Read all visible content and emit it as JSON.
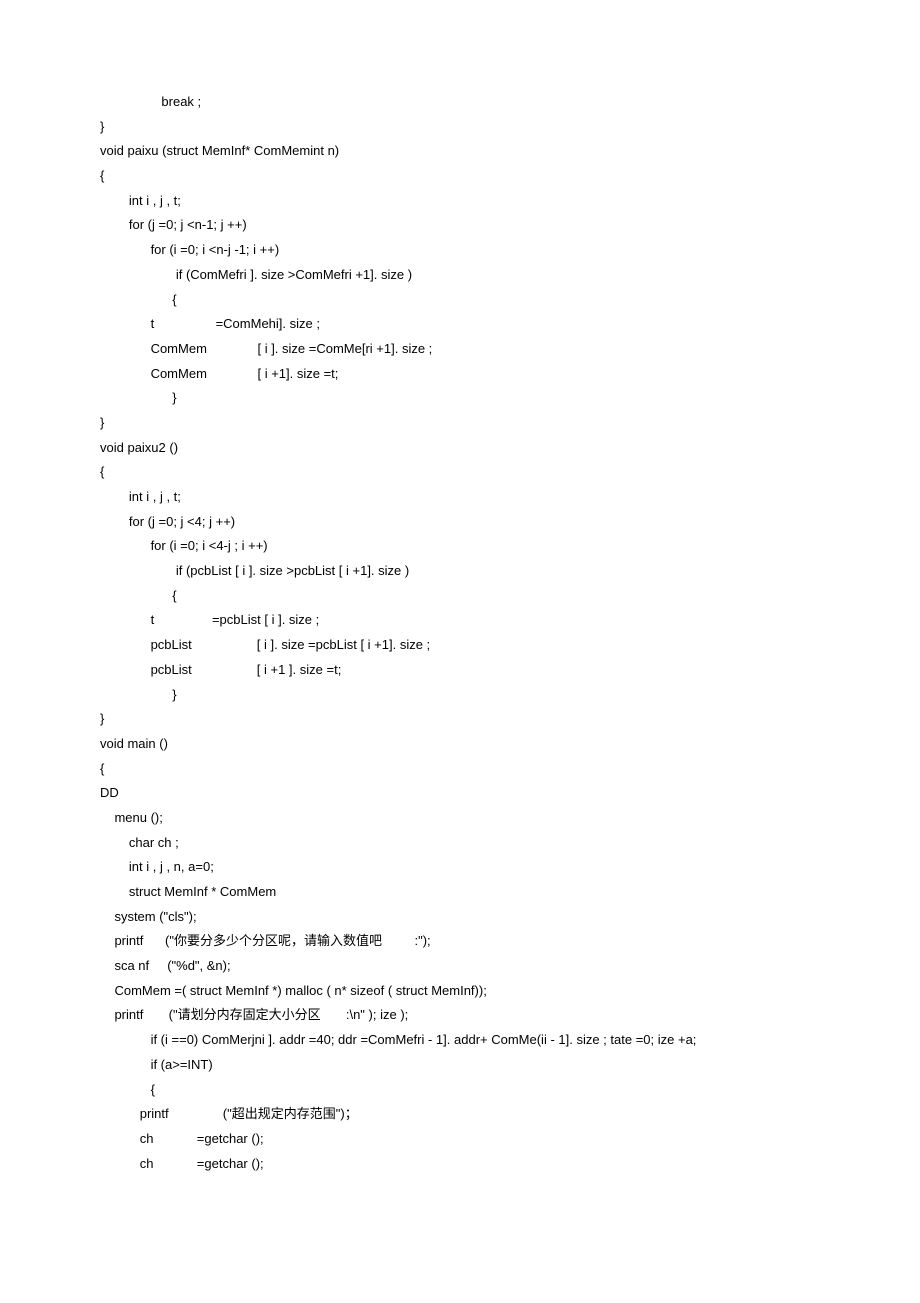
{
  "lines": [
    "                 break ;",
    "}",
    "void paixu (struct MemInf* ComMemint n)",
    "{",
    "        int i , j , t;",
    "        for (j =0; j <n-1; j ++)",
    "              for (i =0; i <n-j -1; i ++)",
    "                     if (ComMefri ]. size >ComMefri +1]. size )",
    "                    {",
    "              t                 =ComMehi]. size ;",
    "              ComMem              [ i ]. size =ComMe[ri +1]. size ;",
    "              ComMem              [ i +1]. size =t;",
    "                    }",
    "}",
    "void paixu2 ()",
    "{",
    "        int i , j , t;",
    "        for (j =0; j <4; j ++)",
    "              for (i =0; i <4-j ; i ++)",
    "                     if (pcbList [ i ]. size >pcbList [ i +1]. size )",
    "                    {",
    "              t                =pcbList [ i ]. size ;",
    "              pcbList                  [ i ]. size =pcbList [ i +1]. size ;",
    "              pcbList                  [ i +1 ]. size =t;",
    "                    }",
    "}",
    "void main ()",
    "{",
    "DD",
    "    menu ();",
    "        char ch ;",
    "        int i , j , n, a=0;",
    "        struct MemInf * ComMem",
    "    system (\"cls\");",
    "    printf      (\"你要分多少个分区呢，请输入数值吧         :\");",
    "    sca nf     (\"%d\", &n);",
    "    ComMem =( struct MemInf *) malloc ( n* sizeof ( struct MemInf));",
    "    printf       (\"请划分内存固定大小分区       :\\n\" ); ize );",
    "              if (i ==0) ComMerjni ]. addr =40; ddr =ComMefri - 1]. addr+ ComMe(ii - 1]. size ; tate =0; ize +a;",
    "              if (a>=INT)",
    "              {",
    "           printf               (\"超出规定内存范围\")；",
    "           ch            =getchar ();",
    "           ch            =getchar ();"
  ]
}
